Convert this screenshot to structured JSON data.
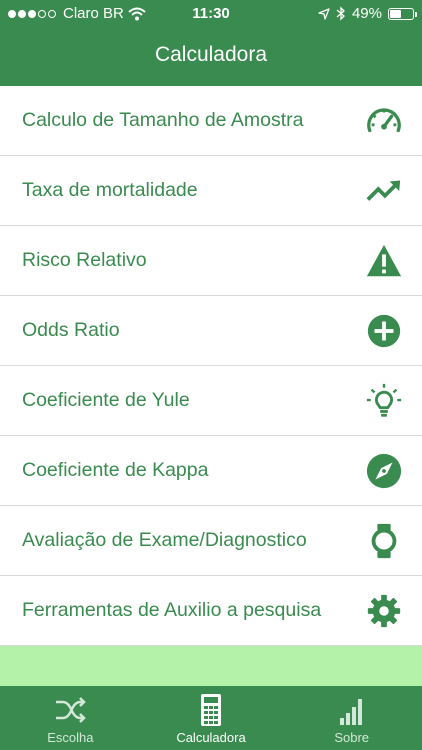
{
  "status_bar": {
    "carrier": "Claro BR",
    "time": "11:30",
    "battery_percent": "49%",
    "battery_level": 0.49
  },
  "nav": {
    "title": "Calculadora"
  },
  "list": {
    "items": [
      {
        "label": "Calculo de Tamanho de Amostra",
        "icon": "speedometer-icon"
      },
      {
        "label": "Taxa de mortalidade",
        "icon": "trending-up-icon"
      },
      {
        "label": "Risco Relativo",
        "icon": "warning-icon"
      },
      {
        "label": "Odds Ratio",
        "icon": "plus-circle-icon"
      },
      {
        "label": "Coeficiente de Yule",
        "icon": "lightbulb-icon"
      },
      {
        "label": "Coeficiente de Kappa",
        "icon": "compass-icon"
      },
      {
        "label": "Avaliação de Exame/Diagnostico",
        "icon": "watch-icon"
      },
      {
        "label": "Ferramentas de Auxilio a pesquisa",
        "icon": "gear-icon"
      }
    ]
  },
  "tabs": [
    {
      "label": "Escolha",
      "icon": "shuffle-icon",
      "active": false
    },
    {
      "label": "Calculadora",
      "icon": "calculator-icon",
      "active": true
    },
    {
      "label": "Sobre",
      "icon": "signal-bars-icon",
      "active": false
    }
  ],
  "colors": {
    "primary": "#3a8b4f",
    "footer_band": "#b3f2a8",
    "divider": "#d9d9d9"
  }
}
